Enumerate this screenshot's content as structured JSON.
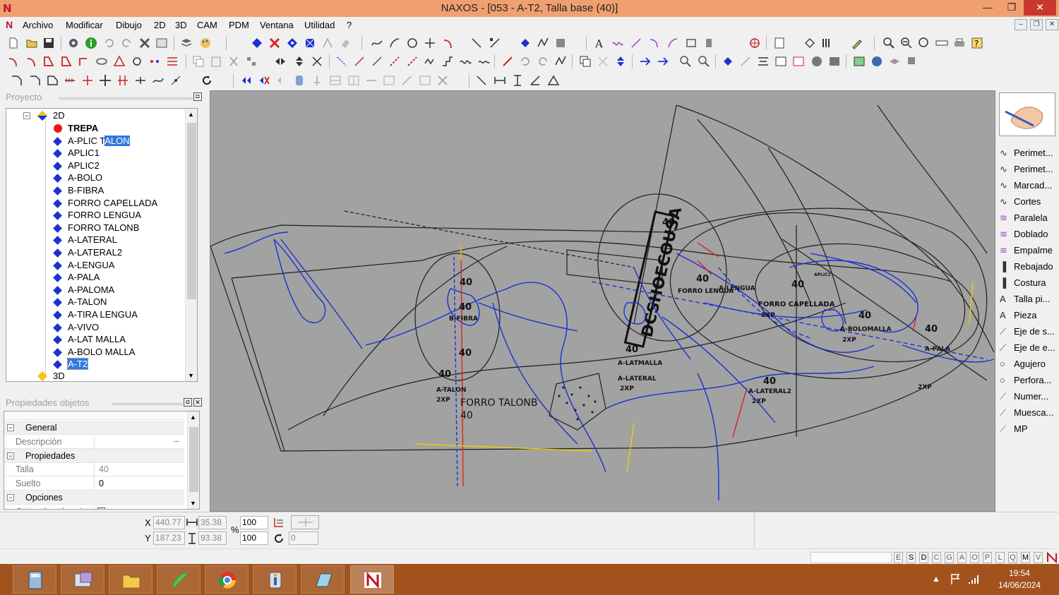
{
  "window": {
    "title": "NAXOS - [053 - A-T2, Talla base (40)]",
    "controls": {
      "minimize": "—",
      "maximize": "❐",
      "close": "✕"
    }
  },
  "menu": [
    "Archivo",
    "Modificar",
    "Dibujo",
    "2D",
    "3D",
    "CAM",
    "PDM",
    "Ventana",
    "Utilidad",
    "?"
  ],
  "mdi_controls": [
    "–",
    "❐",
    "✕"
  ],
  "project": {
    "header": "Proyecto",
    "root": "2D",
    "items": [
      {
        "label": "TREPA",
        "bold": true,
        "marker": "red-dot"
      },
      {
        "label": "A-PLIC TALON",
        "highlight": "ALON"
      },
      {
        "label": "APLIC1"
      },
      {
        "label": "APLIC2"
      },
      {
        "label": "A-BOLO"
      },
      {
        "label": "B-FIBRA"
      },
      {
        "label": "FORRO CAPELLADA"
      },
      {
        "label": "FORRO LENGUA"
      },
      {
        "label": "FORRO TALONB"
      },
      {
        "label": "A-LATERAL"
      },
      {
        "label": "A-LATERAL2"
      },
      {
        "label": "A-LENGUA"
      },
      {
        "label": "A-PALA"
      },
      {
        "label": "A-PALOMA"
      },
      {
        "label": "A-TALON"
      },
      {
        "label": "A-TIRA LENGUA"
      },
      {
        "label": "A-VIVO"
      },
      {
        "label": "A-LAT MALLA"
      },
      {
        "label": "A-BOLO MALLA"
      },
      {
        "label": "A-T2",
        "selected": true
      }
    ],
    "footer_node": "3D"
  },
  "properties": {
    "header": "Propiedades objetos",
    "rows": [
      {
        "type": "section",
        "label": "General"
      },
      {
        "type": "field",
        "label": "Descripción",
        "value": "",
        "button": "..."
      },
      {
        "type": "section",
        "label": "Propiedades"
      },
      {
        "type": "field",
        "label": "Talla",
        "value": "40"
      },
      {
        "type": "field",
        "label": "Suelto",
        "value": "0"
      },
      {
        "type": "section",
        "label": "Opciones"
      },
      {
        "type": "field",
        "label": "Cortar ángulos vivos",
        "value": ""
      }
    ]
  },
  "canvas_labels": {
    "stamp": "DCSHOECOUSA",
    "forro_talonb": "FORRO TALONB",
    "size_40": "40",
    "forro_capellada": "FORRO CAPELLADA",
    "a_talon": "A-TALON",
    "two_xp": "2XP",
    "b_fibra": "B-FIBRA",
    "a_lateral": "A-LATERAL",
    "a_lateral2": "A-LATERAL2",
    "a_latmalla": "A-LATMALLA",
    "a_pala": "A-PALA",
    "a_bolo_malla": "A-BOLOMALLA",
    "forro_lengua": "FORRO LENGUA",
    "a_lengua": "A-LENGUA",
    "a_paloma": "A-PALOMA",
    "aplic1": "APLIC1"
  },
  "palette": {
    "items": [
      "Perimet...",
      "Perimet...",
      "Marcad...",
      "Cortes",
      "Paralela",
      "Doblado",
      "Empalme",
      "Rebajado",
      "Costura",
      "Talla pi...",
      "Pieza",
      "Eje de s...",
      "Eje de e...",
      "Agujero",
      "Perfora...",
      "Numer...",
      "Muesca...",
      "MP"
    ]
  },
  "coords": {
    "x_label": "X",
    "y_label": "Y",
    "x": "440.77",
    "y": "187.23",
    "dx": "35.38",
    "dy": "93.38",
    "pct_label": "%",
    "scale_x": "100",
    "scale_y": "100",
    "rotation": "0"
  },
  "status_keys": [
    "E",
    "S",
    "D",
    "C",
    "G",
    "A",
    "O",
    "P",
    "L",
    "Q",
    "M",
    "V"
  ],
  "taskbar": {
    "time": "19:54",
    "date": "14/06/2024"
  }
}
